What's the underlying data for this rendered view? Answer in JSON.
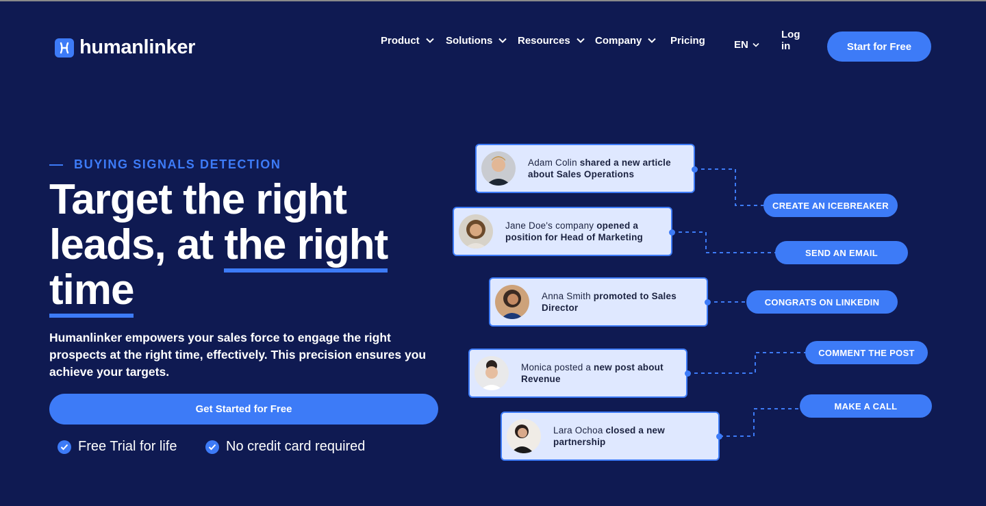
{
  "brand": {
    "name": "humanlinker"
  },
  "nav": {
    "items": [
      {
        "label": "Product"
      },
      {
        "label": "Solutions"
      },
      {
        "label": "Resources"
      },
      {
        "label": "Company"
      },
      {
        "label": "Pricing"
      }
    ],
    "language": "EN",
    "login": "Log in",
    "cta": "Start for Free"
  },
  "hero": {
    "eyebrow": "BUYING SIGNALS DETECTION",
    "headline": {
      "line1": "Target the right",
      "line2_plain": "leads, at ",
      "line2_underlined": "the right",
      "line3_underlined": "time"
    },
    "description": "Humanlinker empowers your sales force to engage the right prospects at the right time, effectively. This precision ensures you achieve your targets.",
    "cta": "Get Started for Free",
    "features": [
      {
        "label": "Free Trial for life"
      },
      {
        "label": "No credit card required"
      }
    ]
  },
  "signals": [
    {
      "name_text": "Adam Colin ",
      "event_text": "shared a new article about Sales Operations",
      "action": "CREATE AN ICEBREAKER"
    },
    {
      "name_text": "Jane Doe's company ",
      "event_text": "opened a position for Head of Marketing",
      "action": "SEND AN EMAIL"
    },
    {
      "name_text": "Anna Smith ",
      "event_text": "promoted to Sales Director",
      "action": "CONGRATS ON LINKEDIN"
    },
    {
      "name_text": "Monica posted a ",
      "event_text": "new post about Revenue",
      "action": "COMMENT THE POST"
    },
    {
      "name_text": "Lara Ochoa ",
      "event_text": "closed a new partnership",
      "action": "MAKE A CALL"
    }
  ],
  "colors": {
    "background": "#0f1a52",
    "accent": "#3d7bf7",
    "card": "#dfe8ff"
  }
}
